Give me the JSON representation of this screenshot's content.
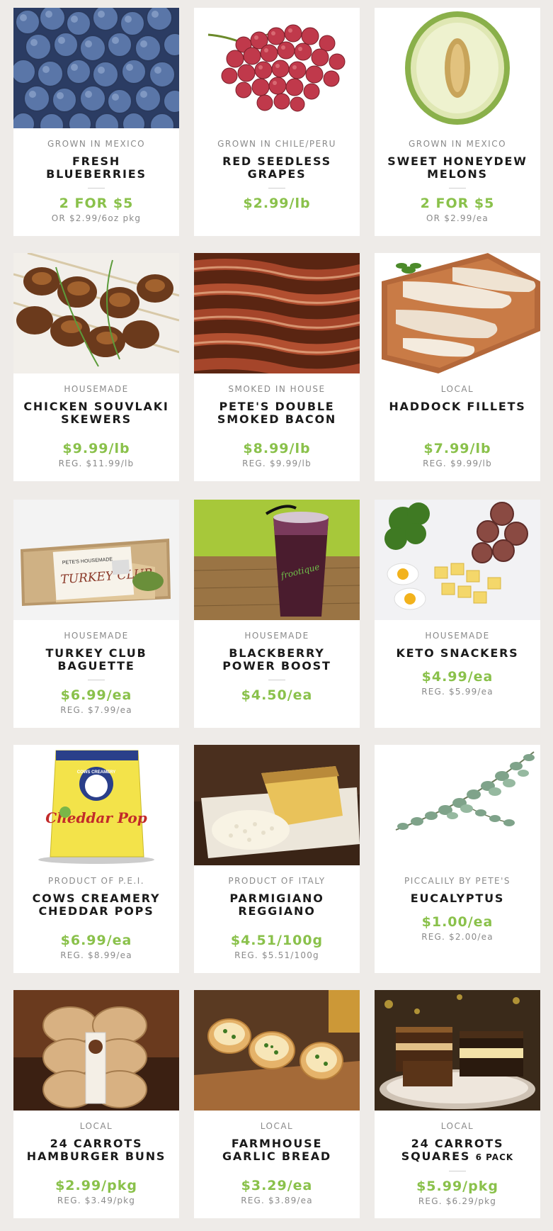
{
  "products": [
    {
      "origin": "GROWN IN MEXICO",
      "title": "FRESH BLUEBERRIES",
      "suffix": "",
      "price": "2 FOR $5",
      "reg": "OR $2.99/6oz pkg",
      "image": "blueberries"
    },
    {
      "origin": "GROWN IN CHILE/PERU",
      "title": "RED SEEDLESS GRAPES",
      "suffix": "",
      "price": "$2.99/lb",
      "reg": "",
      "image": "grapes"
    },
    {
      "origin": "GROWN IN MEXICO",
      "title": "SWEET HONEYDEW MELONS",
      "suffix": "",
      "price": "2 FOR $5",
      "reg": "OR $2.99/ea",
      "image": "honeydew"
    },
    {
      "origin": "HOUSEMADE",
      "title": "CHICKEN SOUVLAKI SKEWERS",
      "suffix": "",
      "price": "$9.99/lb",
      "reg": "REG. $11.99/lb",
      "image": "skewers"
    },
    {
      "origin": "SMOKED IN HOUSE",
      "title": "PETE'S DOUBLE SMOKED BACON",
      "suffix": "",
      "price": "$8.99/lb",
      "reg": "REG. $9.99/lb",
      "image": "bacon"
    },
    {
      "origin": "LOCAL",
      "title": "HADDOCK FILLETS",
      "suffix": "",
      "price": "$7.99/lb",
      "reg": "REG. $9.99/lb",
      "image": "haddock"
    },
    {
      "origin": "HOUSEMADE",
      "title": "TURKEY CLUB BAGUETTE",
      "suffix": "",
      "price": "$6.99/ea",
      "reg": "REG. $7.99/ea",
      "image": "sandwich",
      "package_label": "PETE'S HOUSEMADE",
      "package_text": "TURKEY CLUB"
    },
    {
      "origin": "HOUSEMADE",
      "title": "BLACKBERRY POWER BOOST",
      "suffix": "",
      "price": "$4.50/ea",
      "reg": "",
      "image": "smoothie",
      "cup_label": "frootique"
    },
    {
      "origin": "HOUSEMADE",
      "title": "KETO SNACKERS",
      "suffix": "",
      "price": "$4.99/ea",
      "reg": "REG. $5.99/ea",
      "image": "keto"
    },
    {
      "origin": "PRODUCT OF P.E.I.",
      "title": "COWS CREAMERY CHEDDAR POPS",
      "suffix": "",
      "price": "$6.99/ea",
      "reg": "REG. $8.99/ea",
      "image": "cheddar-pop",
      "package_brand": "COWS CREAMERY",
      "package_text": "Cheddar Pop"
    },
    {
      "origin": "PRODUCT OF ITALY",
      "title": "PARMIGIANO REGGIANO",
      "suffix": "",
      "price": "$4.51/100g",
      "reg": "REG. $5.51/100g",
      "image": "parmesan"
    },
    {
      "origin": "PICCALILY BY PETE'S",
      "title": "EUCALYPTUS",
      "suffix": "",
      "price": "$1.00/ea",
      "reg": "REG. $2.00/ea",
      "image": "eucalyptus"
    },
    {
      "origin": "LOCAL",
      "title": "24 CARROTS HAMBURGER BUNS",
      "suffix": "",
      "price": "$2.99/pkg",
      "reg": "REG. $3.49/pkg",
      "image": "buns"
    },
    {
      "origin": "LOCAL",
      "title": "FARMHOUSE GARLIC BREAD",
      "suffix": "",
      "price": "$3.29/ea",
      "reg": "REG. $3.89/ea",
      "image": "garlic-bread"
    },
    {
      "origin": "LOCAL",
      "title": "24 CARROTS SQUARES",
      "suffix": "6 PACK",
      "price": "$5.99/pkg",
      "reg": "REG. $6.29/pkg",
      "image": "squares"
    }
  ],
  "colors": {
    "price": "#8ac14b",
    "background": "#eeebe8",
    "card": "#ffffff",
    "origin": "#8a8a8a",
    "title": "#1a1a1a"
  }
}
